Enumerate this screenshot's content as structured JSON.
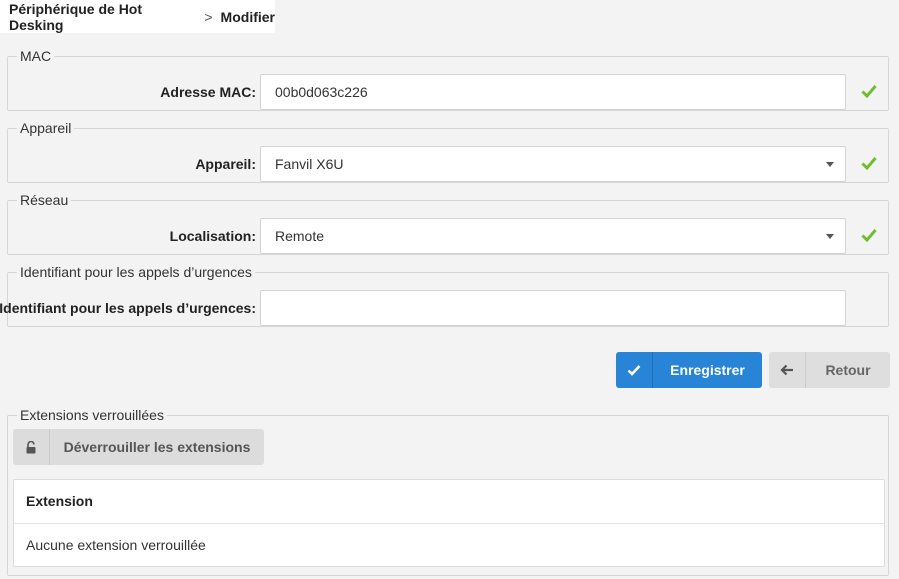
{
  "breadcrumb": {
    "parent": "Périphérique de Hot Desking",
    "separator": ">",
    "current": "Modifier"
  },
  "sections": {
    "mac": {
      "legend": "MAC",
      "label": "Adresse MAC:",
      "value": "00b0d063c226"
    },
    "device": {
      "legend": "Appareil",
      "label": "Appareil:",
      "value": "Fanvil X6U"
    },
    "network": {
      "legend": "Réseau",
      "label": "Localisation:",
      "value": "Remote"
    },
    "emergency": {
      "legend": "Identifiant pour les appels d’urgences",
      "label": "Identifiant pour les appels d’urgences:",
      "value": ""
    }
  },
  "actions": {
    "save_label": "Enregistrer",
    "back_label": "Retour"
  },
  "locked_extensions": {
    "legend": "Extensions verrouillées",
    "unlock_label": "Déverrouiller les extensions",
    "column_header": "Extension",
    "empty_text": "Aucune extension verrouillée"
  },
  "colors": {
    "primary": "#2784d6",
    "valid": "#6cc02f"
  },
  "icons": {
    "valid": "check-icon",
    "save": "check-icon",
    "back": "arrow-left-icon",
    "unlock": "unlock-icon"
  }
}
